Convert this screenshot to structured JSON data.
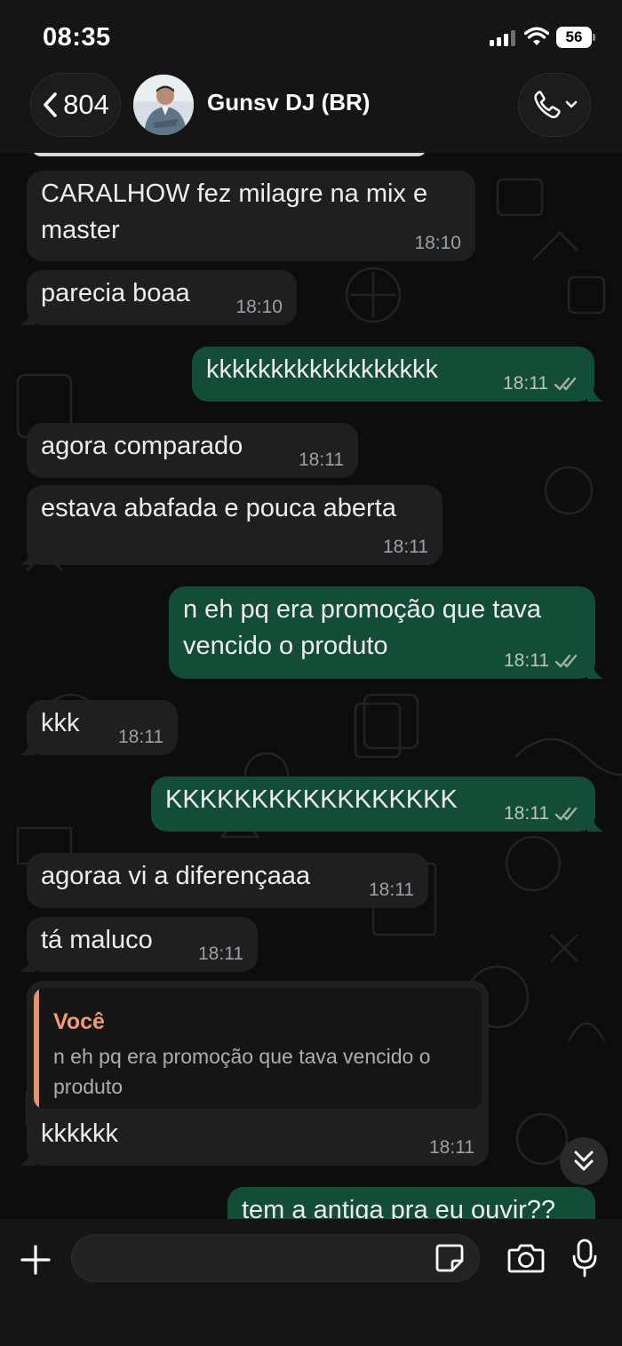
{
  "status_bar": {
    "time": "08:35",
    "battery": "56"
  },
  "header": {
    "back_count": "804",
    "contact_name": "Gunsv DJ (BR)"
  },
  "messages": [
    {
      "dir": "in",
      "text": "CARALHOW fez milagre na mix e\nmaster",
      "time": "18:10"
    },
    {
      "dir": "in",
      "text": "parecia boaa",
      "time": "18:10"
    },
    {
      "dir": "out",
      "text": "kkkkkkkkkkkkkkkkkk",
      "time": "18:11",
      "status": "read"
    },
    {
      "dir": "in",
      "text": "agora comparado",
      "time": "18:11"
    },
    {
      "dir": "in",
      "text": "estava abafada e pouca aberta",
      "time": "18:11"
    },
    {
      "dir": "out",
      "text": "n eh pq era promoção que tava\nvencido o produto",
      "time": "18:11",
      "status": "read"
    },
    {
      "dir": "in",
      "text": "kkk",
      "time": "18:11"
    },
    {
      "dir": "out",
      "text": "KKKKKKKKKKKKKKKKK",
      "time": "18:11",
      "status": "read"
    },
    {
      "dir": "in",
      "text": "agoraa vi a diferençaaa",
      "time": "18:11"
    },
    {
      "dir": "in",
      "text": "tá maluco",
      "time": "18:11"
    },
    {
      "dir": "in",
      "text": "kkkkkk",
      "time": "18:11",
      "reply": {
        "author": "Você",
        "text": "n eh pq era promoção que tava vencido o produto"
      }
    },
    {
      "dir": "out",
      "text": "tem a antiga pra eu ouvir??",
      "time": "",
      "status": ""
    }
  ],
  "composer": {
    "placeholder": ""
  },
  "icons": {
    "back": "chevron-left-icon",
    "call": "phone-icon",
    "scroll": "double-chevron-down-icon",
    "plus": "plus-icon",
    "sticker": "sticker-icon",
    "camera": "camera-icon",
    "mic": "microphone-icon",
    "read": "double-check-icon"
  },
  "colors": {
    "incoming_bubble": "#1f1f1f",
    "outgoing_bubble": "#144d37",
    "reply_author": "#f39a73",
    "background": "#0d0d0d"
  }
}
